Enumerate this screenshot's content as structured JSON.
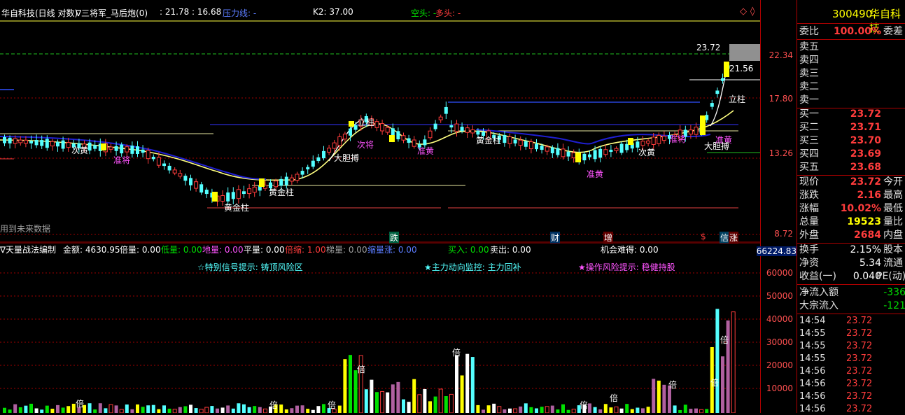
{
  "header": {
    "title": "华自科技(日线 对数)",
    "indicator": "∇三将军_马后炮(0)",
    "ratio": ": 21.78 : 16.68",
    "line_label": "压力线: -",
    "k2": "K2: 37.00",
    "kong": "空头: -",
    "duo": "多头: -"
  },
  "main_axis": [
    "22.34",
    "17.80",
    "13.26",
    "8.72"
  ],
  "price_labels": {
    "high": "23.72",
    "last": "21.56"
  },
  "annotations": [
    {
      "text": "次黄",
      "cls": "white"
    },
    {
      "text": "准将",
      "cls": "magenta"
    },
    {
      "text": "黄金柱",
      "cls": "white"
    },
    {
      "text": "黄金柱",
      "cls": "white"
    },
    {
      "text": "大胆搏",
      "cls": "white"
    },
    {
      "text": "次将",
      "cls": "magenta"
    },
    {
      "text": "立柱",
      "cls": "white"
    },
    {
      "text": "准黄",
      "cls": "magenta"
    },
    {
      "text": "黄金柱",
      "cls": "white"
    },
    {
      "text": "准黄",
      "cls": "magenta"
    },
    {
      "text": "次黄",
      "cls": "white"
    },
    {
      "text": "准将",
      "cls": "magenta"
    },
    {
      "text": "立柱",
      "cls": "white"
    },
    {
      "text": "准黄",
      "cls": "magenta"
    },
    {
      "text": "大胆搏",
      "cls": "white"
    }
  ],
  "future_data": "用到未来数据",
  "bottom_tags": [
    "跌",
    "财",
    "增",
    "$",
    "信",
    "涨"
  ],
  "indicator_bar": {
    "name": "∇天量战法编制",
    "amount": "金额: 4630.95",
    "bei": "倍量: 0.00",
    "di": "低量: 0.00",
    "diliang": "地量: 0.00",
    "ping": "平量: 0.00",
    "beisuo": "倍缩: 1.00",
    "ti": "梯量: 0.00",
    "suo": "缩量涨: 0.00",
    "buy": "买入: 0.00",
    "sell": "卖出: 0.00",
    "chance": "机会难得: 0.00"
  },
  "signals": {
    "s1": "☆特别信号提示: 铸顶风险区",
    "s2": "★主力动向监控: 主力回补",
    "s3": "★操作风险提示: 稳健持股"
  },
  "vol_marks": [
    "倍",
    "倍",
    "倍",
    "倍",
    "倍",
    "倍",
    "倍",
    "倍",
    "倍",
    "倍"
  ],
  "vol_axis": [
    "66224.83",
    "60000",
    "50000",
    "40000",
    "30000",
    "20000",
    "10000"
  ],
  "quote": {
    "code": "300490",
    "name": "华自科技",
    "weibi_label": "委比",
    "weibi_value": "100.00%",
    "weicha_label": "委差",
    "asks": [
      {
        "label": "卖五",
        "price": "",
        "vol": ""
      },
      {
        "label": "卖四",
        "price": "",
        "vol": ""
      },
      {
        "label": "卖三",
        "price": "",
        "vol": ""
      },
      {
        "label": "卖二",
        "price": "",
        "vol": ""
      },
      {
        "label": "卖一",
        "price": "",
        "vol": ""
      }
    ],
    "bids": [
      {
        "label": "买一",
        "price": "23.72"
      },
      {
        "label": "买二",
        "price": "23.71"
      },
      {
        "label": "买三",
        "price": "23.70"
      },
      {
        "label": "买四",
        "price": "23.69"
      },
      {
        "label": "买五",
        "price": "23.68"
      }
    ],
    "stats": [
      {
        "label": "现价",
        "value": "23.72",
        "label2": "今开",
        "cls": "red"
      },
      {
        "label": "涨跌",
        "value": "2.16",
        "label2": "最高",
        "cls": "red"
      },
      {
        "label": "涨幅",
        "value": "10.02%",
        "label2": "最低",
        "cls": "red"
      },
      {
        "label": "总量",
        "value": "19523",
        "label2": "量比",
        "cls": "yellow"
      },
      {
        "label": "外盘",
        "value": "2684",
        "label2": "内盘",
        "cls": "red"
      }
    ],
    "stats2": [
      {
        "label": "换手",
        "value": "2.15%",
        "label2": "股本",
        "cls": "white"
      },
      {
        "label": "净资",
        "value": "5.34",
        "label2": "流通",
        "cls": "white"
      },
      {
        "label": "收益(一)",
        "value": "0.040",
        "label2": "PE(动)",
        "cls": "white"
      }
    ],
    "flows": [
      {
        "label": "净流入额",
        "value": "-336"
      },
      {
        "label": "大宗流入",
        "value": "-121"
      }
    ],
    "ticks": [
      {
        "t": "14:54",
        "p": "23.72"
      },
      {
        "t": "14:55",
        "p": "23.72"
      },
      {
        "t": "14:55",
        "p": "23.72"
      },
      {
        "t": "14:55",
        "p": "23.72"
      },
      {
        "t": "14:56",
        "p": "23.72"
      },
      {
        "t": "14:56",
        "p": "23.72"
      },
      {
        "t": "14:56",
        "p": "23.72"
      },
      {
        "t": "14:56",
        "p": "23.72"
      }
    ]
  },
  "colors": {
    "up": "#ff3c3c",
    "down": "#54ffff",
    "gold": "#ffff00",
    "ma_blue": "#1f1fd0",
    "ma_yellow": "#ffff80",
    "grid_red": "#b00000"
  }
}
